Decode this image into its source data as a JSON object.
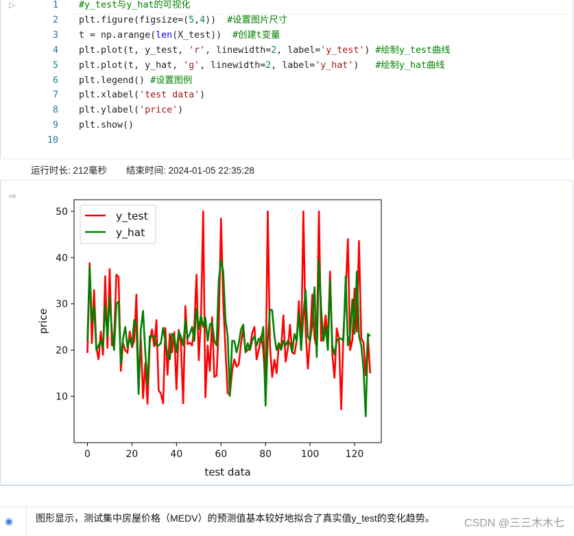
{
  "code": {
    "lines": [
      {
        "n": "1",
        "tokens": [
          {
            "t": "#y_test与y_hat的可视化",
            "c": "cmt"
          }
        ]
      },
      {
        "n": "2",
        "tokens": [
          {
            "t": "plt.figure(figsize=(",
            "c": ""
          },
          {
            "t": "5",
            "c": "num"
          },
          {
            "t": ",",
            "c": ""
          },
          {
            "t": "4",
            "c": "num"
          },
          {
            "t": "))  ",
            "c": ""
          },
          {
            "t": "#设置图片尺寸",
            "c": "cmt"
          }
        ]
      },
      {
        "n": "3",
        "tokens": [
          {
            "t": "t = np.arange(",
            "c": ""
          },
          {
            "t": "len",
            "c": "bi"
          },
          {
            "t": "(X_test))  ",
            "c": ""
          },
          {
            "t": "#创建t变量",
            "c": "cmt"
          }
        ]
      },
      {
        "n": "4",
        "tokens": [
          {
            "t": "plt.plot(t, y_test, ",
            "c": ""
          },
          {
            "t": "'r'",
            "c": "str"
          },
          {
            "t": ", linewidth=",
            "c": ""
          },
          {
            "t": "2",
            "c": "num"
          },
          {
            "t": ", label=",
            "c": ""
          },
          {
            "t": "'y_test'",
            "c": "str"
          },
          {
            "t": ") ",
            "c": ""
          },
          {
            "t": "#绘制y_test曲线",
            "c": "cmt"
          }
        ]
      },
      {
        "n": "5",
        "tokens": [
          {
            "t": "plt.plot(t, y_hat, ",
            "c": ""
          },
          {
            "t": "'g'",
            "c": "str"
          },
          {
            "t": ", linewidth=",
            "c": ""
          },
          {
            "t": "2",
            "c": "num"
          },
          {
            "t": ", label=",
            "c": ""
          },
          {
            "t": "'y_hat'",
            "c": "str"
          },
          {
            "t": ")   ",
            "c": ""
          },
          {
            "t": "#绘制y_hat曲线",
            "c": "cmt"
          }
        ]
      },
      {
        "n": "6",
        "tokens": [
          {
            "t": "plt.legend() ",
            "c": ""
          },
          {
            "t": "#设置图例",
            "c": "cmt"
          }
        ]
      },
      {
        "n": "7",
        "tokens": [
          {
            "t": "plt.xlabel(",
            "c": ""
          },
          {
            "t": "'test data'",
            "c": "str"
          },
          {
            "t": ")",
            "c": ""
          }
        ]
      },
      {
        "n": "8",
        "tokens": [
          {
            "t": "plt.ylabel(",
            "c": ""
          },
          {
            "t": "'price'",
            "c": "str"
          },
          {
            "t": ")",
            "c": ""
          }
        ]
      },
      {
        "n": "9",
        "tokens": [
          {
            "t": "plt.show()",
            "c": ""
          }
        ]
      },
      {
        "n": "10",
        "tokens": []
      }
    ]
  },
  "run_meta": {
    "duration": "运行时长: 212毫秒",
    "end_time": "结束时间: 2024-01-05 22:35:28"
  },
  "icons": {
    "run": "play-triangle-icon",
    "output": "output-export-icon",
    "markdown": "eye-icon"
  },
  "chart_data": {
    "type": "line",
    "xlabel": "test data",
    "ylabel": "price",
    "xlim": [
      -6,
      132
    ],
    "ylim": [
      0,
      52.5
    ],
    "xticks": [
      0,
      20,
      40,
      60,
      80,
      100,
      120
    ],
    "yticks": [
      10,
      20,
      30,
      40,
      50
    ],
    "legend": "top-left",
    "grid": false,
    "x_start": 0,
    "series": [
      {
        "name": "y_test",
        "color": "#ff0000",
        "values": [
          19.4,
          38.8,
          21.5,
          33,
          20.5,
          18,
          24,
          19,
          36,
          20.5,
          37.5,
          21,
          22.5,
          36.3,
          35.8,
          15.5,
          21.5,
          20,
          19.4,
          24,
          20.6,
          22,
          32,
          11.7,
          22.5,
          9.6,
          17.2,
          8.4,
          21.6,
          24.5,
          20.8,
          26.5,
          11.3,
          10.6,
          8.5,
          24.8,
          14.7,
          23.5,
          19.5,
          23.9,
          11.5,
          24.4,
          21.5,
          8.5,
          29.5,
          21.3,
          21.6,
          21,
          25,
          36.3,
          17.8,
          26.5,
          50,
          9.8,
          21,
          15.5,
          27.1,
          14.2,
          14.5,
          25.1,
          48.4,
          30.5,
          20,
          10.7,
          10.4,
          15.5,
          18,
          16.4,
          17,
          21.5,
          24.6,
          19.6,
          20,
          20.5,
          23.7,
          25,
          18,
          20,
          23,
          20,
          12,
          50,
          20.8,
          14.2,
          17.9,
          15,
          21.5,
          20.2,
          27.5,
          17.5,
          20.3,
          25.5,
          19.5,
          19.2,
          22,
          30.6,
          20,
          50,
          24.4,
          16,
          22.5,
          32,
          22.6,
          20.5,
          50,
          22,
          23,
          27.5,
          22,
          37,
          19,
          14,
          24.7,
          22.4,
          7.2,
          24,
          32.5,
          44,
          20,
          22.2,
          33.3,
          24,
          43.6,
          22.5,
          21.7,
          14.6,
          23,
          15
        ]
      },
      {
        "name": "y_hat",
        "color": "#008000",
        "values": [
          22,
          38,
          26,
          29.5,
          20,
          21,
          22,
          20.5,
          29.5,
          23,
          31.5,
          24,
          20,
          30,
          30.5,
          17,
          22.5,
          25,
          20.5,
          22.5,
          21,
          26.5,
          25.5,
          10.5,
          24.5,
          28.5,
          19.5,
          12.5,
          23,
          23,
          23,
          21,
          21,
          21.5,
          24.8,
          22,
          19,
          18,
          23.5,
          23,
          19.5,
          24,
          23,
          21,
          26.5,
          22.5,
          23.5,
          25,
          22,
          29,
          24.5,
          27.5,
          25,
          27,
          22,
          25.5,
          26,
          22,
          21,
          35,
          39.5,
          37,
          26.5,
          23,
          10.1,
          22,
          22,
          19.5,
          21.5,
          24.5,
          25.5,
          19.5,
          21.5,
          20,
          22,
          23,
          21,
          22.5,
          22,
          25,
          8,
          22,
          28.8,
          28.6,
          23,
          20,
          21.5,
          20,
          22,
          21,
          22,
          21.5,
          19.5,
          23.5,
          22,
          28,
          20,
          27.5,
          33,
          23,
          22,
          25.5,
          33.6,
          18.5,
          39.5,
          29,
          22,
          25,
          20,
          35,
          21,
          19,
          22,
          22.5,
          22.5,
          22,
          36,
          21,
          23.5,
          31,
          23.5,
          37,
          23,
          21,
          16,
          5.7,
          23.5,
          23
        ]
      }
    ]
  },
  "markdown": {
    "text": "图形显示，测试集中房屋价格（MEDV）的预测值基本较好地拟合了真实值y_test的变化趋势。"
  },
  "watermark": "CSDN @三三木木七"
}
